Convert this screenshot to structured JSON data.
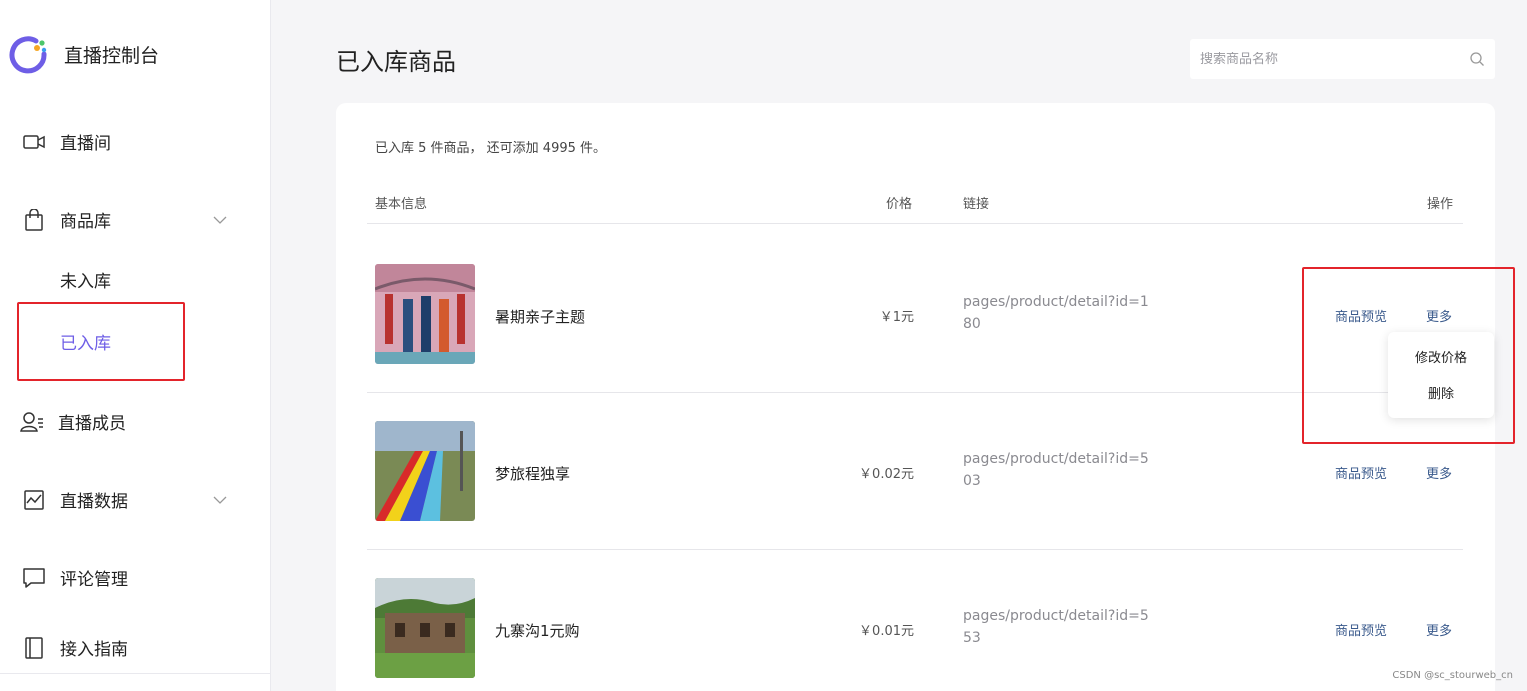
{
  "brand": {
    "name": "直播控制台"
  },
  "sidebar": {
    "items": [
      {
        "label": "直播间",
        "icon": "video-camera-icon"
      },
      {
        "label": "商品库",
        "icon": "shopping-bag-icon"
      },
      {
        "label": "直播成员",
        "icon": "member-icon"
      },
      {
        "label": "直播数据",
        "icon": "data-chart-icon"
      },
      {
        "label": "评论管理",
        "icon": "comment-icon"
      },
      {
        "label": "接入指南",
        "icon": "book-icon"
      }
    ],
    "sub_items": [
      {
        "label": "未入库",
        "active": false
      },
      {
        "label": "已入库",
        "active": true
      }
    ]
  },
  "page": {
    "title": "已入库商品",
    "search_placeholder": "搜索商品名称"
  },
  "summary": "已入库 5 件商品， 还可添加 4995 件。",
  "table": {
    "headers": {
      "info": "基本信息",
      "price": "价格",
      "link": "链接",
      "action": "操作"
    },
    "rows": [
      {
        "name": "暑期亲子主题",
        "price": "￥1元",
        "link": "pages/product/detail?id=180",
        "preview": "商品预览",
        "more": "更多"
      },
      {
        "name": "梦旅程独享",
        "price": "￥0.02元",
        "link": "pages/product/detail?id=503",
        "preview": "商品预览",
        "more": "更多"
      },
      {
        "name": "九寨沟1元购",
        "price": "￥0.01元",
        "link": "pages/product/detail?id=553",
        "preview": "商品预览",
        "more": "更多"
      }
    ]
  },
  "more_menu": {
    "items": [
      "修改价格",
      "删除"
    ]
  },
  "watermark": "CSDN @sc_stourweb_cn",
  "colors": {
    "accent": "#6e5ee6",
    "link": "#3a5a8c",
    "annotation": "#e3242b"
  }
}
